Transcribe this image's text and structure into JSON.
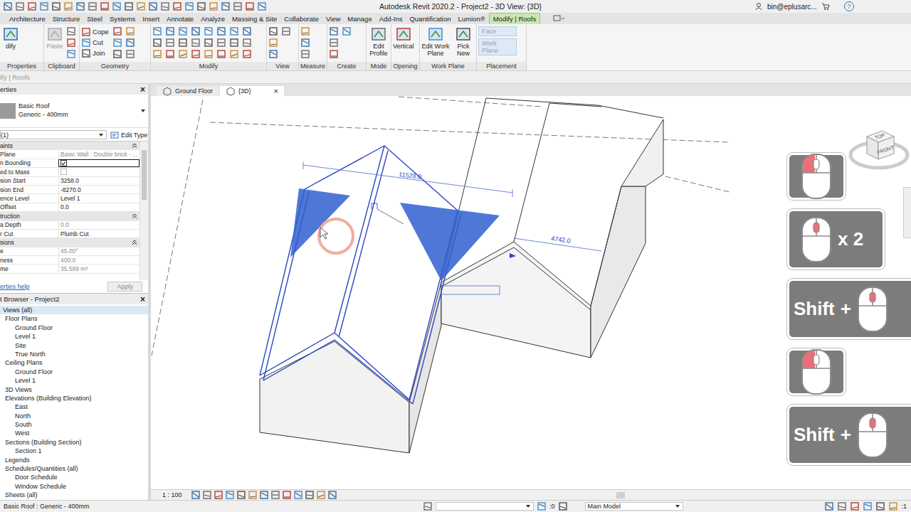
{
  "window": {
    "title": "Autodesk Revit 2020.2 - Project2 - 3D View: {3D}",
    "user": "bin@eplusarc...",
    "help": "?"
  },
  "ribbon_tabs": [
    {
      "label": "Architecture",
      "selected": false
    },
    {
      "label": "Structure",
      "selected": false
    },
    {
      "label": "Steel",
      "selected": false
    },
    {
      "label": "Systems",
      "selected": false
    },
    {
      "label": "Insert",
      "selected": false
    },
    {
      "label": "Annotate",
      "selected": false
    },
    {
      "label": "Analyze",
      "selected": false
    },
    {
      "label": "Massing & Site",
      "selected": false
    },
    {
      "label": "Collaborate",
      "selected": false
    },
    {
      "label": "View",
      "selected": false
    },
    {
      "label": "Manage",
      "selected": false
    },
    {
      "label": "Add-Ins",
      "selected": false
    },
    {
      "label": "Quantification",
      "selected": false
    },
    {
      "label": "Lumion®",
      "selected": false
    },
    {
      "label": "Modify | Roofs",
      "selected": true
    }
  ],
  "ribbon_panels": [
    {
      "label": "Properties",
      "tools": [
        {
          "label": "dify",
          "kind": "large",
          "disabled": false
        }
      ]
    },
    {
      "label": "Clipboard",
      "tools": [
        {
          "label": "Paste",
          "kind": "large",
          "disabled": true
        }
      ]
    },
    {
      "label": "Geometry",
      "tools": [
        {
          "label": "Cope",
          "kind": "small",
          "disabled": false
        },
        {
          "label": "Cut",
          "kind": "small",
          "disabled": false
        },
        {
          "label": "Join",
          "kind": "small",
          "disabled": false
        }
      ]
    },
    {
      "label": "Modify",
      "tools": []
    },
    {
      "label": "View",
      "tools": []
    },
    {
      "label": "Measure",
      "tools": []
    },
    {
      "label": "Create",
      "tools": []
    },
    {
      "label": "Mode",
      "tools": [
        {
          "label": "Edit Profile",
          "kind": "large",
          "disabled": false
        }
      ]
    },
    {
      "label": "Opening",
      "tools": [
        {
          "label": "Vertical",
          "kind": "large",
          "disabled": false
        }
      ]
    },
    {
      "label": "Work Plane",
      "tools": [
        {
          "label": "Edit Work Plane",
          "kind": "large",
          "disabled": false
        },
        {
          "label": "Pick New",
          "kind": "large",
          "disabled": false
        }
      ]
    },
    {
      "label": "Placement",
      "tools": [
        {
          "label": "Face",
          "kind": "wide",
          "disabled": true
        },
        {
          "label": "Work Plane",
          "kind": "wide",
          "disabled": true
        }
      ]
    }
  ],
  "options_bar": {
    "label": "ify | Roofs"
  },
  "properties": {
    "title": "erties",
    "close": "×",
    "type_name": "Basic Roof",
    "type_sub": "Generic - 400mm",
    "selector": "(1)",
    "edit_type": "Edit Type",
    "rows": [
      {
        "kind": "section",
        "label": "aints",
        "expanded": true
      },
      {
        "kind": "prop",
        "label": "Plane",
        "value": "Basic Wall : Double brick - ...",
        "disabled": true,
        "focused": false
      },
      {
        "kind": "check",
        "label": "n Bounding",
        "checked": true,
        "disabled": false,
        "focused": true
      },
      {
        "kind": "check",
        "label": "ed to Mass",
        "checked": false,
        "disabled": true,
        "focused": false
      },
      {
        "kind": "prop",
        "label": "sion Start",
        "value": "3258.0",
        "disabled": false,
        "focused": false
      },
      {
        "kind": "prop",
        "label": "sion End",
        "value": "-8270.0",
        "disabled": false,
        "focused": false
      },
      {
        "kind": "prop",
        "label": "ence Level",
        "value": "Level 1",
        "disabled": false,
        "focused": false
      },
      {
        "kind": "prop",
        "label": "Offset",
        "value": "0.0",
        "disabled": false,
        "focused": false
      },
      {
        "kind": "section",
        "label": "truction",
        "expanded": true
      },
      {
        "kind": "prop",
        "label": "a Depth",
        "value": "0.0",
        "disabled": true,
        "focused": false
      },
      {
        "kind": "prop",
        "label": "r Cut",
        "value": "Plumb Cut",
        "disabled": false,
        "focused": false
      },
      {
        "kind": "section",
        "label": "sions",
        "expanded": true
      },
      {
        "kind": "prop",
        "label": "e",
        "value": "45.00°",
        "disabled": true,
        "focused": false
      },
      {
        "kind": "prop",
        "label": "ness",
        "value": "400.0",
        "disabled": true,
        "focused": false
      },
      {
        "kind": "prop",
        "label": "me",
        "value": "35.589 m³",
        "disabled": true,
        "focused": false
      }
    ],
    "help": "erties help",
    "apply": "Apply",
    "apply_disabled": true
  },
  "browser": {
    "title": "t Browser - Project2",
    "close": "×",
    "items": [
      {
        "label": "Views (all)",
        "level": 0,
        "selected": true
      },
      {
        "label": "Floor Plans",
        "level": 1,
        "selected": false
      },
      {
        "label": "Ground Floor",
        "level": 2,
        "selected": false
      },
      {
        "label": "Level 1",
        "level": 2,
        "selected": false
      },
      {
        "label": "Site",
        "level": 2,
        "selected": false
      },
      {
        "label": "True North",
        "level": 2,
        "selected": false
      },
      {
        "label": "Ceiling Plans",
        "level": 1,
        "selected": false
      },
      {
        "label": "Ground Floor",
        "level": 2,
        "selected": false
      },
      {
        "label": "Level 1",
        "level": 2,
        "selected": false
      },
      {
        "label": "3D Views",
        "level": 1,
        "selected": false
      },
      {
        "label": "Elevations (Building Elevation)",
        "level": 1,
        "selected": false
      },
      {
        "label": "East",
        "level": 2,
        "selected": false
      },
      {
        "label": "North",
        "level": 2,
        "selected": false
      },
      {
        "label": "South",
        "level": 2,
        "selected": false
      },
      {
        "label": "West",
        "level": 2,
        "selected": false
      },
      {
        "label": "Sections (Building Section)",
        "level": 1,
        "selected": false
      },
      {
        "label": "Section 1",
        "level": 2,
        "selected": false
      },
      {
        "label": "Legends",
        "level": 1,
        "selected": false
      },
      {
        "label": "Schedules/Quantities (all)",
        "level": 1,
        "selected": false
      },
      {
        "label": "Door Schedule",
        "level": 2,
        "selected": false
      },
      {
        "label": "Window Schedule",
        "level": 2,
        "selected": false
      },
      {
        "label": "Sheets (all)",
        "level": 1,
        "selected": false
      }
    ]
  },
  "view_tabs": [
    {
      "label": "Ground Floor",
      "selected": false,
      "close": ""
    },
    {
      "label": "{3D}",
      "selected": true,
      "close": "×"
    }
  ],
  "canvas": {
    "roof_selected": true,
    "dimensions": [
      {
        "text": "11528.0"
      },
      {
        "text": "4742.0"
      }
    ]
  },
  "viewcube": {
    "top": "TOP",
    "front": "FRONT"
  },
  "mouse_hints": [
    {
      "kind": "mouse",
      "button": "left"
    },
    {
      "kind": "repeat",
      "button": "middle",
      "text": "x 2"
    },
    {
      "kind": "modifier",
      "button": "middle",
      "key": "Shift",
      "plus": "+"
    },
    {
      "kind": "mouse",
      "button": "left"
    },
    {
      "kind": "modifier",
      "button": "middle",
      "key": "Shift",
      "plus": "+"
    }
  ],
  "view_control": {
    "scale": "1 : 100"
  },
  "status_bar": {
    "text": "Basic Roof : Generic - 400mm",
    "count": ":0",
    "model": "Main Model",
    "filter": ":1"
  }
}
